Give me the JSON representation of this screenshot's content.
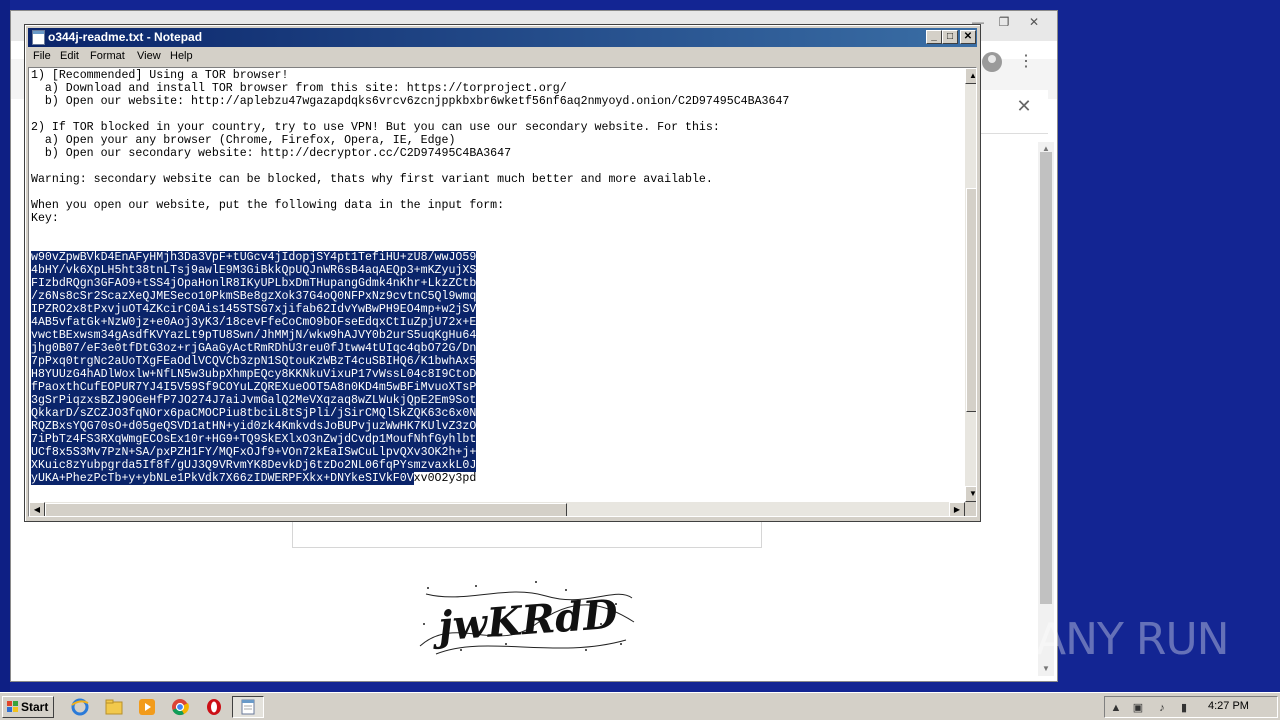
{
  "notepad": {
    "title": "o344j-readme.txt - Notepad",
    "menu": [
      "File",
      "Edit",
      "Format",
      "View",
      "Help"
    ],
    "lines": [
      "1) [Recommended] Using a TOR browser!",
      "  a) Download and install TOR browser from this site: https://torproject.org/",
      "  b) Open our website: http://aplebzu47wgazapdqks6vrcv6zcnjppkbxbr6wketf56nf6aq2nmyoyd.onion/C2D97495C4BA3647",
      "",
      "2) If TOR blocked in your country, try to use VPN! But you can use our secondary website. For this:",
      "  a) Open your any browser (Chrome, Firefox, Opera, IE, Edge)",
      "  b) Open our secondary website: http://decryptor.cc/C2D97495C4BA3647",
      "",
      "Warning: secondary website can be blocked, thats why first variant much better and more available.",
      "",
      "When you open our website, put the following data in the input form:",
      "Key:",
      "",
      ""
    ],
    "key_lines": [
      "w90vZpwBVkD4EnAFyHMjh3Da3VpF+tUGcv4jIdopjSY4pt1TefiHU+zU8/wwJO59",
      "4bHY/vk6XpLH5ht38tnLTsj9awlE9M3GiBkkQpUQJnWR6sB4aqAEQp3+mKZyujXS",
      "FIzbdRQgn3GFAO9+tSS4jOpaHonlR8IKyUPLbxDmTHupangGdmk4nKhr+LkzZCtb",
      "/z6Ns8cSr2ScazXeQJMESeco10PkmSBe8gzXok37G4oQ0NFPxNz9cvtnC5Ql9wmq",
      "IPZRO2x8tPxvjuOT4ZKcirC0Ais145STSG7xjifab62IdvYwBwPH9EO4mp+w2jSV",
      "4AB5vfatGk+NzW0jz+e0Aoj3yK3/18cevFfeCoCmO9bOFseEdqxCtIuZpjU72x+E",
      "vwctBExwsm34gAsdfKVYazLt9pTU8Swn/JhMMjN/wkw9hAJVY0b2urS5uqKgHu64",
      "jhg0B07/eF3e0tfDtG3oz+rjGAaGyActRmRDhU3reu0fJtww4tUIqc4qbO72G/Dn",
      "7pPxq0trgNc2aUoTXgFEaOdlVCQVCb3zpN1SQtouKzWBzT4cuSBIHQ6/K1bwhAx5",
      "H8YUUzG4hADlWoxlw+NfLN5w3ubpXhmpEQcy8KKNkuVixuP17vWssL04c8I9CtoD",
      "fPaoxthCufEOPUR7YJ4I5V59Sf9COYuLZQREXueOOT5A8n0KD4m5wBFiMvuoXTsP",
      "3gSrPiqzxsBZJ9OGeHfP7JO274J7aiJvmGalQ2MeVXqzaq8wZLWukjQpE2Em9Sot",
      "QkkarD/sZCZJO3fqNOrx6paCMOCPiu8tbciL8tSjPli/jSirCMQlSkZQK63c6x0N",
      "RQZBxsYQG70sO+d05geQSVD1atHN+yid0zk4KmkvdsJoBUPvjuzWwHK7KUlvZ3zO",
      "7iPbTz4FS3RXqWmgECOsEx10r+HG9+TQ9SkEXlxO3nZwjdCvdp1MoufNhfGyhlbt",
      "UCf8x5S3Mv7PzN+SA/pxPZH1FY/MQFxOJf9+VOn72kEaISwCuLlpvQXv3OK2h+j+",
      "XKuic8zYubpgrda5If8f/gUJ3Q9VRvmYK8DevkDj6tzDo2NL06fqPYsmzvaxkL0J"
    ],
    "key_last_selected": "yUKA+PhezPcTb+y+ybNLe1PkVdk7X66zIDWERPFXkx+DNYkeSIVkF0V",
    "key_last_unselected": "xv0O2y3pd"
  },
  "browser": {
    "captcha_text": "jwKRdD"
  },
  "watermark": "ANY RUN",
  "taskbar": {
    "start_label": "Start",
    "clock": "4:27 PM"
  },
  "colors": {
    "desktop": "#132593",
    "titlebar_start": "#0a246a",
    "titlebar_end": "#3a6ea5",
    "selection": "#0a246a"
  }
}
